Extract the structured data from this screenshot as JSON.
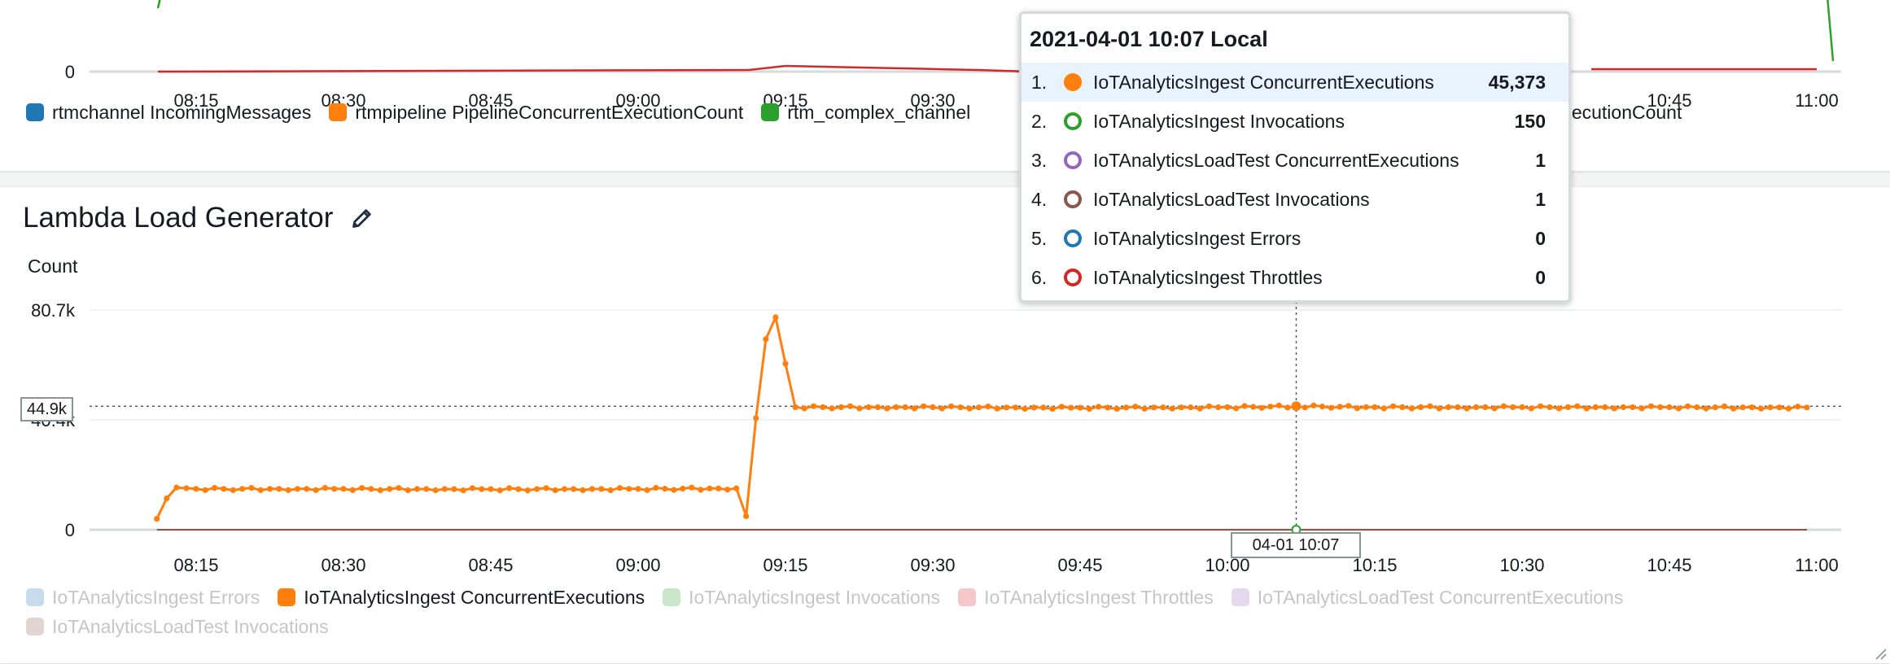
{
  "top_chart": {
    "x_ticks": [
      "08:15",
      "08:30",
      "08:45",
      "09:00",
      "09:15",
      "09:30",
      "09:45",
      "10:00",
      "10:15",
      "10:30",
      "10:45",
      "11:00"
    ],
    "y_ticks": [
      "0"
    ],
    "legend": [
      {
        "label": "rtmchannel IncomingMessages",
        "color": "#1f77b4"
      },
      {
        "label": "rtmpipeline PipelineConcurrentExecutionCount",
        "color": "#ff7f0e"
      },
      {
        "label": "rtm_complex_channel",
        "color": "#2ca02c"
      },
      {
        "label": "entExecutionCount",
        "color": "#ffffff"
      }
    ]
  },
  "panel": {
    "title": "Lambda Load Generator",
    "y_axis_label": "Count",
    "icons": [
      "document-icon",
      "refresh-icon",
      "expand-icon",
      "more-options-icon"
    ]
  },
  "tooltip": {
    "header": "2021-04-01 10:07 Local",
    "rows": [
      {
        "rank": "1.",
        "name": "IoTAnalyticsIngest ConcurrentExecutions",
        "value": "45,373",
        "color": "#ff7f0e",
        "filled": true
      },
      {
        "rank": "2.",
        "name": "IoTAnalyticsIngest Invocations",
        "value": "150",
        "color": "#2ca02c",
        "filled": false
      },
      {
        "rank": "3.",
        "name": "IoTAnalyticsLoadTest ConcurrentExecutions",
        "value": "1",
        "color": "#9467bd",
        "filled": false
      },
      {
        "rank": "4.",
        "name": "IoTAnalyticsLoadTest Invocations",
        "value": "1",
        "color": "#8c564b",
        "filled": false
      },
      {
        "rank": "5.",
        "name": "IoTAnalyticsIngest Errors",
        "value": "0",
        "color": "#1f77b4",
        "filled": false
      },
      {
        "rank": "6.",
        "name": "IoTAnalyticsIngest Throttles",
        "value": "0",
        "color": "#d62728",
        "filled": false
      }
    ]
  },
  "cursor": {
    "y_value": "44.9k",
    "x_value": "04-01 10:07"
  },
  "chart_data": {
    "type": "line",
    "title": "Lambda Load Generator",
    "ylabel": "Count",
    "x_ticks": [
      "08:15",
      "08:30",
      "08:45",
      "09:00",
      "09:15",
      "09:30",
      "09:45",
      "10:00",
      "10:15",
      "10:30",
      "10:45",
      "11:00"
    ],
    "y_ticks": [
      "0",
      "40.4k",
      "80.7k"
    ],
    "ylim": [
      0,
      80700
    ],
    "x": [
      "08:11",
      "08:12",
      "08:13",
      "08:15",
      "08:30",
      "08:45",
      "09:00",
      "09:10",
      "09:11",
      "09:12",
      "09:13",
      "09:14",
      "09:15",
      "09:16",
      "09:30",
      "09:45",
      "10:00",
      "10:07",
      "10:15",
      "10:30",
      "10:45",
      "10:59"
    ],
    "series": [
      {
        "name": "IoTAnalyticsIngest ConcurrentExecutions",
        "color": "#ff7f0e",
        "values": [
          4000,
          11500,
          15500,
          15000,
          15000,
          14900,
          15000,
          15200,
          5000,
          41000,
          70000,
          78000,
          61000,
          45000,
          45000,
          44800,
          45000,
          45373,
          45000,
          45000,
          45000,
          44900
        ]
      },
      {
        "name": "IoTAnalyticsIngest Errors",
        "color": "#1f77b4",
        "values": []
      },
      {
        "name": "IoTAnalyticsIngest Invocations",
        "color": "#2ca02c",
        "values": []
      },
      {
        "name": "IoTAnalyticsIngest Throttles",
        "color": "#d62728",
        "values": []
      },
      {
        "name": "IoTAnalyticsLoadTest ConcurrentExecutions",
        "color": "#9467bd",
        "values": []
      },
      {
        "name": "IoTAnalyticsLoadTest Invocations",
        "color": "#8c564b",
        "values": []
      }
    ],
    "legend": [
      {
        "label": "IoTAnalyticsIngest Errors",
        "color": "#1f77b4",
        "active": false
      },
      {
        "label": "IoTAnalyticsIngest ConcurrentExecutions",
        "color": "#ff7f0e",
        "active": true
      },
      {
        "label": "IoTAnalyticsIngest Invocations",
        "color": "#2ca02c",
        "active": false
      },
      {
        "label": "IoTAnalyticsIngest Throttles",
        "color": "#d62728",
        "active": false
      },
      {
        "label": "IoTAnalyticsLoadTest ConcurrentExecutions",
        "color": "#9467bd",
        "active": false
      },
      {
        "label": "IoTAnalyticsLoadTest Invocations",
        "color": "#8c564b",
        "active": false
      }
    ],
    "grid": true,
    "legend_position": "bottom"
  }
}
